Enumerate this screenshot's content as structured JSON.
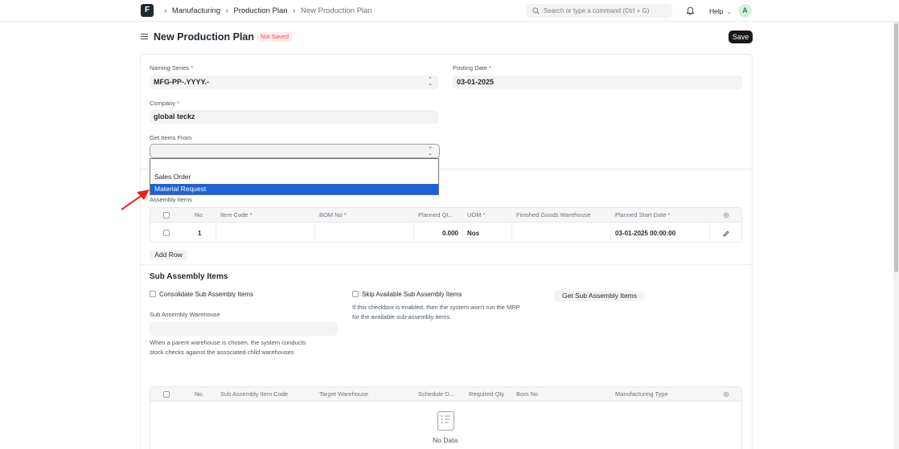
{
  "navbar": {
    "logo": "F",
    "breadcrumbs": [
      "Manufacturing",
      "Production Plan",
      "New Production Plan"
    ],
    "search_placeholder": "Search or type a command (Ctrl + G)",
    "help_label": "Help",
    "avatar_initial": "A"
  },
  "page": {
    "title": "New Production Plan",
    "status": "Not Saved",
    "save_label": "Save"
  },
  "form": {
    "naming_series": {
      "label": "Naming Series",
      "value": "MFG-PP-.YYYY.-"
    },
    "posting_date": {
      "label": "Posting Date",
      "value": "03-01-2025"
    },
    "company": {
      "label": "Company",
      "value": "global teckz"
    },
    "get_items_from": {
      "label": "Get Items From",
      "value": "",
      "options": [
        "Sales Order",
        "Material Request"
      ],
      "highlighted": "Material Request"
    }
  },
  "assembly": {
    "label": "Assembly Items",
    "columns": [
      "No.",
      "Item Code",
      "BOM No",
      "Planned Qt...",
      "UOM",
      "Finished Goods Warehouse",
      "Planned Start Date"
    ],
    "rows": [
      {
        "no": "1",
        "item_code": "",
        "bom_no": "",
        "planned_qty": "0.000",
        "uom": "Nos",
        "warehouse": "",
        "start_date": "03-01-2025 00:00:00"
      }
    ],
    "add_row_label": "Add Row"
  },
  "sub_assembly": {
    "title": "Sub Assembly Items",
    "consolidate_label": "Consolidate Sub Assembly Items",
    "skip_label": "Skip Available Sub Assembly Items",
    "skip_desc_1": "If this checkbox is enabled, then the system won't run the MRP",
    "skip_desc_2": "for the available sub-assembly items.",
    "get_button_label": "Get Sub Assembly Items",
    "warehouse_label": "Sub Assembly Warehouse",
    "warehouse_desc_1": "When a parent warehouse is chosen, the system conducts",
    "warehouse_desc_2": "stock checks against the associated child warehouses",
    "columns": [
      "No.",
      "Sub Assembly Item Code",
      "Target Warehouse",
      "Schedule D...",
      "Required Qty",
      "Bom No",
      "Manufacturing Type"
    ],
    "no_data": "No Data"
  }
}
